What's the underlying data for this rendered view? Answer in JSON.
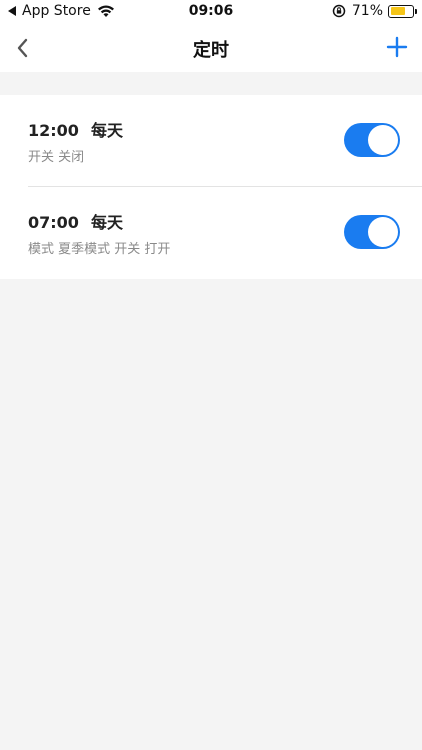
{
  "status_bar": {
    "back_app": "App Store",
    "time": "09:06",
    "battery": "71%",
    "battery_level": 0.71,
    "icons": [
      "back-triangle-icon",
      "wifi-icon",
      "rotation-lock-icon",
      "battery-icon"
    ]
  },
  "nav": {
    "title": "定时",
    "back_icon": "chevron-left-icon",
    "add_icon": "plus-icon",
    "accent": "#1a7cf0"
  },
  "timers": [
    {
      "time": "12:00",
      "repeat": "每天",
      "detail": "开关 关闭",
      "enabled": true
    },
    {
      "time": "07:00",
      "repeat": "每天",
      "detail": "模式 夏季模式  开关 打开",
      "enabled": true
    }
  ],
  "colors": {
    "toggle_on": "#1a7cf0",
    "background": "#f4f4f4",
    "battery": "#f5c518"
  }
}
